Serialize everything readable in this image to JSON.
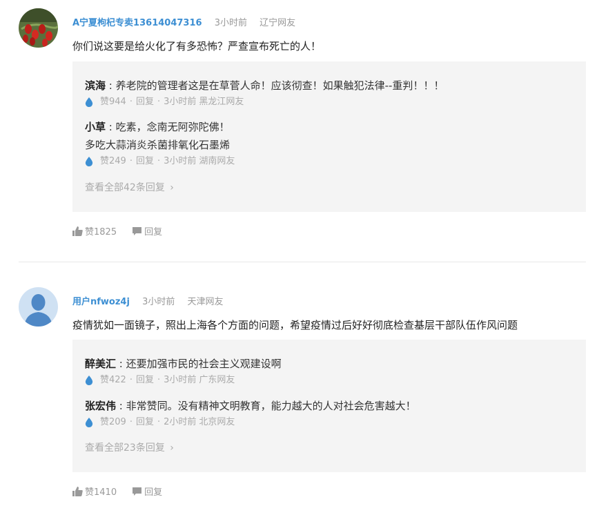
{
  "comments": [
    {
      "user": "A宁夏枸杞专卖13614047316",
      "time": "3小时前",
      "location": "辽宁网友",
      "text": "你们说这要是给火化了有多恐怖？严查宣布死亡的人！",
      "replies": [
        {
          "author": "滨海",
          "sep": " : ",
          "lines": [
            "养老院的管理者这是在草菅人命！应该彻查！如果触犯法律--重判！！！"
          ],
          "likes": "赞944",
          "reply_label": "回复",
          "time": "3小时前",
          "location": "黑龙江网友"
        },
        {
          "author": "小草",
          "sep": " : ",
          "lines": [
            "吃素，念南无阿弥陀佛！",
            "多吃大蒜消炎杀菌排氧化石墨烯"
          ],
          "likes": "赞249",
          "reply_label": "回复",
          "time": "3小时前",
          "location": "湖南网友"
        }
      ],
      "view_all": "查看全部42条回复",
      "likes": "赞1825",
      "reply_label": "回复"
    },
    {
      "user": "用户nfwoz4j",
      "time": "3小时前",
      "location": "天津网友",
      "text": "疫情犹如一面镜子，照出上海各个方面的问题，希望疫情过后好好彻底检查基层干部队伍作风问题",
      "replies": [
        {
          "author": "醉美汇",
          "sep": " : ",
          "lines": [
            "还要加强市民的社会主义观建设啊"
          ],
          "likes": "赞422",
          "reply_label": "回复",
          "time": "3小时前",
          "location": "广东网友"
        },
        {
          "author": "张宏伟",
          "sep": " : ",
          "lines": [
            "非常赞同。没有精神文明教育，能力越大的人对社会危害越大！"
          ],
          "likes": "赞209",
          "reply_label": "回复",
          "time": "2小时前",
          "location": "北京网友"
        }
      ],
      "view_all": "查看全部23条回复",
      "likes": "赞1410",
      "reply_label": "回复"
    }
  ],
  "dot": "·",
  "chevron": "›",
  "colors": {
    "username": "#3d8fd3",
    "reply_bg": "#f4f4f4",
    "drop": "#3d8fd3"
  },
  "icons": {
    "drop": "water-drop-icon",
    "thumb": "thumb-up-icon",
    "bubble": "comment-bubble-icon",
    "avatar1": "goji-berry-avatar",
    "avatar2": "default-user-avatar"
  }
}
